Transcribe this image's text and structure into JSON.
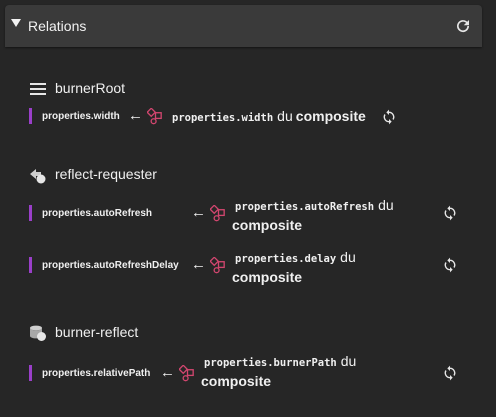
{
  "panel": {
    "title": "Relations"
  },
  "sections": [
    {
      "name": "burnerRoot",
      "icon": "hamburger-icon",
      "relations": [
        {
          "property": "properties.width",
          "target_prop": "properties.width",
          "du": "du",
          "composite": "composite"
        }
      ]
    },
    {
      "name": "reflect-requester",
      "icon": "requester-icon",
      "relations": [
        {
          "property": "properties.autoRefresh",
          "target_prop": "properties.autoRefresh",
          "du": "du",
          "composite": "composite"
        },
        {
          "property": "properties.autoRefreshDelay",
          "target_prop": "properties.delay",
          "du": "du",
          "composite": "composite"
        }
      ]
    },
    {
      "name": "burner-reflect",
      "icon": "database-icon",
      "relations": [
        {
          "property": "properties.relativePath",
          "target_prop": "properties.burnerPath",
          "du": "du",
          "composite": "composite"
        }
      ]
    }
  ],
  "colors": {
    "accent_bar": "#9a3fc9",
    "node_icon": "#d2466f",
    "background": "#262626",
    "header": "#3a3a3a"
  }
}
